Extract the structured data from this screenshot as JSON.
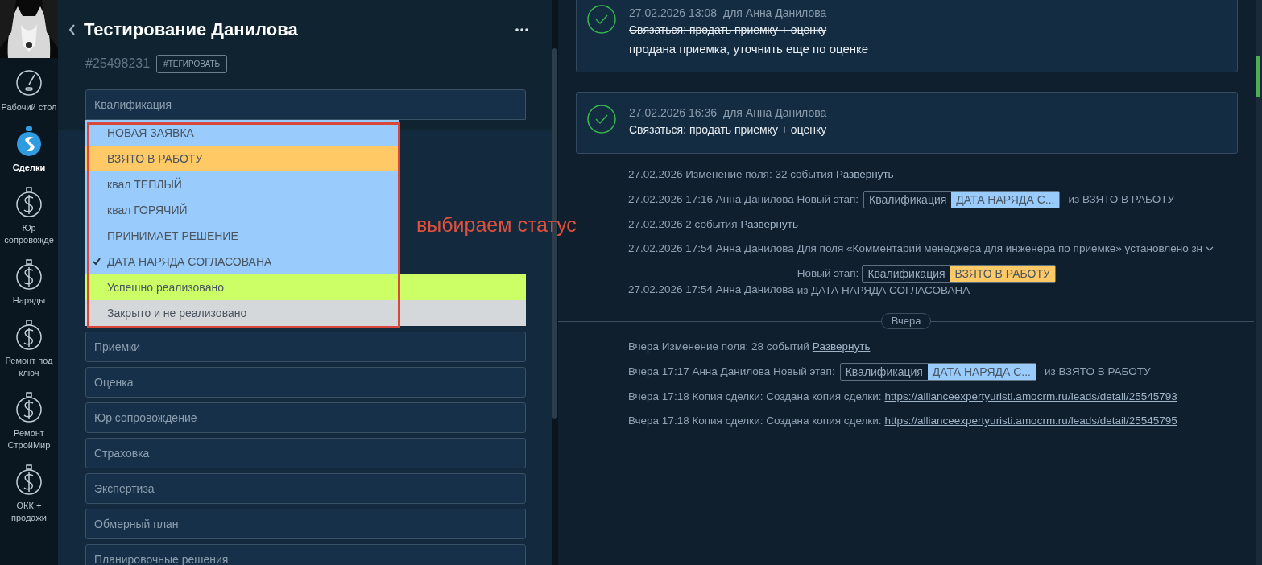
{
  "sidebar": {
    "items": [
      {
        "label": "Рабочий стол",
        "selected": false
      },
      {
        "label": "Сделки",
        "selected": true
      },
      {
        "label": "Юр сопровожде",
        "selected": false
      },
      {
        "label": "Наряды",
        "selected": false
      },
      {
        "label": "Ремонт под ключ",
        "selected": false
      },
      {
        "label": "Ремонт СтройМир",
        "selected": false
      },
      {
        "label": "ОКК + продажи",
        "selected": false
      }
    ]
  },
  "deal": {
    "title": "Тестирование Данилова",
    "id": "#25498231",
    "tag_button": "#ТЕГИРОВАТЬ"
  },
  "pipeline_select": {
    "label": "Квалификация",
    "statuses": [
      {
        "name": "НОВАЯ ЗАЯВКА",
        "color": "#99ccfd",
        "selected": false
      },
      {
        "name": "ВЗЯТО В РАБОТУ",
        "color": "#ffc966",
        "selected": false
      },
      {
        "name": "квал ТЕПЛЫЙ",
        "color": "#99ccfd",
        "selected": false
      },
      {
        "name": "квал ГОРЯЧИЙ",
        "color": "#99ccfd",
        "selected": false
      },
      {
        "name": "ПРИНИМАЕТ РЕШЕНИЕ",
        "color": "#99ccfd",
        "selected": false
      },
      {
        "name": "ДАТА НАРЯДА СОГЛАСОВАНА",
        "color": "#99ccfd",
        "selected": true
      },
      {
        "name": "Успешно реализовано",
        "color": "#ccff66",
        "selected": false
      },
      {
        "name": "Закрыто и не реализовано",
        "color": "#d5d8db",
        "selected": false
      }
    ]
  },
  "pipelines": [
    "Приемки",
    "Оценка",
    "Юр сопровождение",
    "Страховка",
    "Экспертиза",
    "Обмерный план",
    "Планировочные решения"
  ],
  "annotation": "выбираем статус",
  "tasks": [
    {
      "date": "27.02.2026 13:08",
      "for": "для Анна Данилова",
      "task": "Связаться: продать приемку + оценку",
      "done": true,
      "note": "продана приемка, уточнить еще по оценке"
    },
    {
      "date": "27.02.2026 16:36",
      "for": "для Анна Данилова",
      "task": "Связаться: продать приемку + оценку",
      "done": true
    }
  ],
  "event_groups": [
    {
      "events": [
        {
          "kind": "summary",
          "text": "27.02.2026 Изменение поля: 32 события",
          "link": "Развернуть"
        },
        {
          "kind": "stage",
          "text": "27.02.2026 17:16 Анна Данилова Новый этап:",
          "pipeline": "Квалификация",
          "status": "ДАТА НАРЯДА С...",
          "color": "#99ccfd",
          "from": "из ВЗЯТО В РАБОТУ"
        },
        {
          "kind": "summary",
          "text": "27.02.2026 2 события",
          "link": "Развернуть"
        },
        {
          "kind": "field",
          "text": "27.02.2026 17:54 Анна Данилова Для поля «Комментарий менеджера для инженера по приемке» установлено зн"
        },
        {
          "kind": "stage_wrapped",
          "text": "27.02.2026 17:54 Анна Данилова",
          "label": "Новый этап:",
          "pipeline": "Квалификация",
          "status": "ВЗЯТО В РАБОТУ",
          "color": "#ffc966",
          "from": "из ДАТА НАРЯДА СОГЛАСОВАНА"
        }
      ]
    },
    {
      "separator": "Вчера",
      "events": [
        {
          "kind": "summary",
          "text": "Вчера Изменение поля: 28 событий",
          "link": "Развернуть"
        },
        {
          "kind": "stage",
          "text": "Вчера 17:17 Анна Данилова Новый этап:",
          "pipeline": "Квалификация",
          "status": "ДАТА НАРЯДА С...",
          "color": "#99ccfd",
          "from": "из ВЗЯТО В РАБОТУ"
        },
        {
          "kind": "link",
          "text": "Вчера 17:18 Копия сделки: Создана копия сделки:",
          "link": "https://allianceexpertyuristi.amocrm.ru/leads/detail/25545793"
        },
        {
          "kind": "link",
          "text": "Вчера 17:18 Копия сделки: Создана копия сделки:",
          "link": "https://allianceexpertyuristi.amocrm.ru/leads/detail/25545795"
        }
      ]
    }
  ]
}
